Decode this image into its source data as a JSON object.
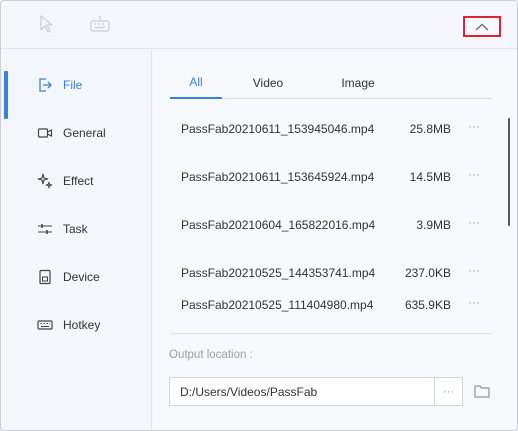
{
  "toolbar": {
    "icons": [
      "cursor-icon",
      "keyboard-icon"
    ],
    "collapse_icon": "chevron-up-icon",
    "highlight_color": "#e0222f"
  },
  "sidebar": {
    "items": [
      {
        "label": "File",
        "icon": "file-export-icon",
        "active": true
      },
      {
        "label": "General",
        "icon": "camera-icon",
        "active": false
      },
      {
        "label": "Effect",
        "icon": "sparkle-icon",
        "active": false
      },
      {
        "label": "Task",
        "icon": "task-sliders-icon",
        "active": false
      },
      {
        "label": "Device",
        "icon": "device-icon",
        "active": false
      },
      {
        "label": "Hotkey",
        "icon": "keyboard-icon",
        "active": false
      }
    ],
    "accent_color": "#3d7fe0"
  },
  "tabs": [
    {
      "label": "All",
      "active": true
    },
    {
      "label": "Video",
      "active": false
    },
    {
      "label": "Image",
      "active": false
    }
  ],
  "files": [
    {
      "name": "PassFab20210611_153945046.mp4",
      "size": "25.8MB",
      "more": "···"
    },
    {
      "name": "PassFab20210611_153645924.mp4",
      "size": "14.5MB",
      "more": "···"
    },
    {
      "name": "PassFab20210604_165822016.mp4",
      "size": "3.9MB",
      "more": "···"
    },
    {
      "name": "PassFab20210525_144353741.mp4",
      "size": "237.0KB",
      "more": "···"
    },
    {
      "name": "PassFab20210525_111404980.mp4",
      "size": "635.9KB",
      "more": "···"
    }
  ],
  "output": {
    "label": "Output location :",
    "path": "D:/Users/Videos/PassFab",
    "more": "···",
    "folder_icon": "folder-icon"
  }
}
